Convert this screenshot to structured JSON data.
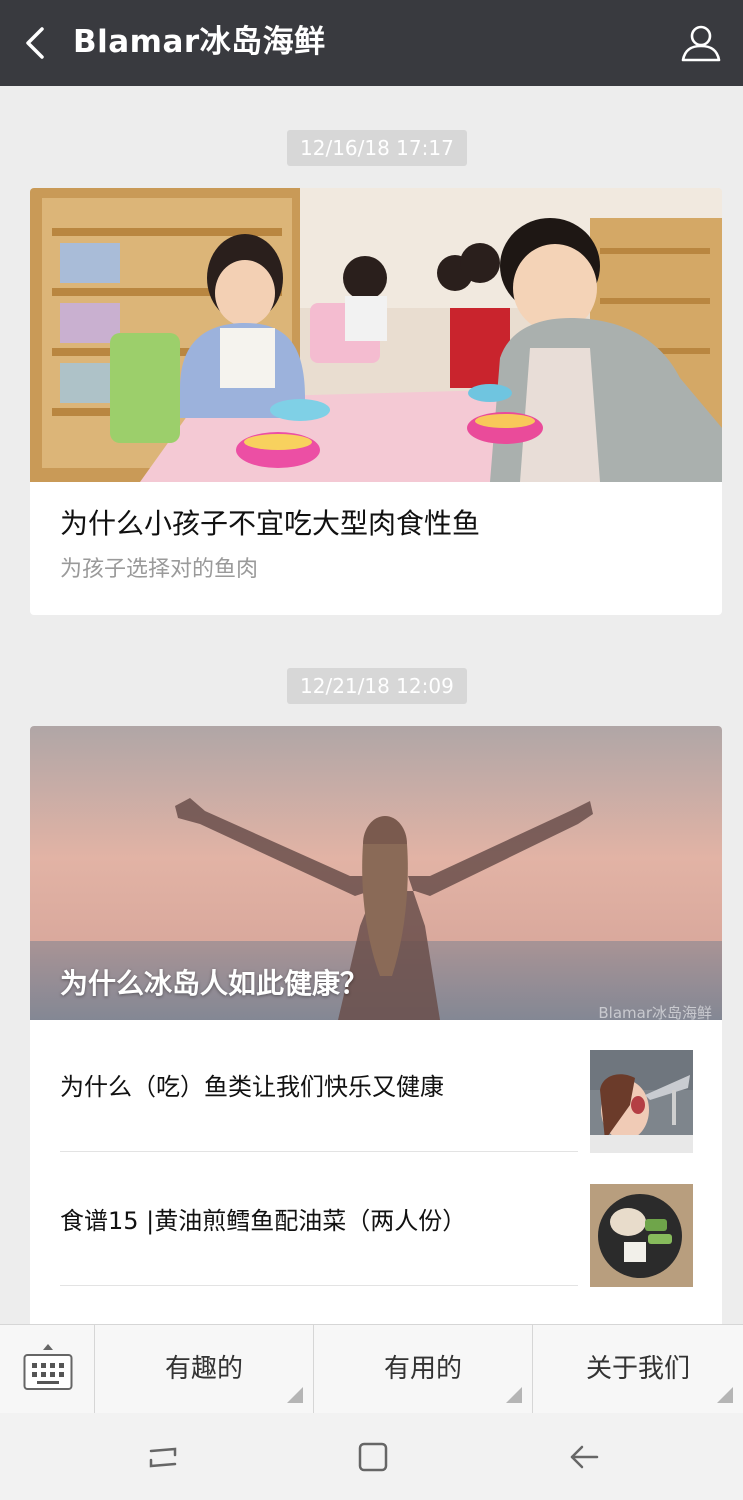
{
  "header": {
    "title": "Blamar冰岛海鲜"
  },
  "feed": {
    "groups": [
      {
        "timestamp": "12/16/18 17:17",
        "cover_title": "",
        "title": "为什么小孩子不宜吃大型肉食性鱼",
        "subtitle": "为孩子选择对的鱼肉"
      },
      {
        "timestamp": "12/21/18 12:09",
        "cover_title": "为什么冰岛人如此健康？",
        "watermark": "Blamar冰岛海鲜",
        "articles": [
          {
            "title": "为什么（吃）鱼类让我们快乐又健康",
            "thumb_icon": "woman-eating-fish-thumbnail"
          },
          {
            "title": "食谱15 |黄油煎鳕鱼配油菜（两人份）",
            "thumb_icon": "cod-dish-thumbnail"
          }
        ]
      }
    ]
  },
  "bottom_menu": {
    "keyboard_icon": "keyboard-icon",
    "items": [
      {
        "label": "有趣的"
      },
      {
        "label": "有用的"
      },
      {
        "label": "关于我们"
      }
    ]
  },
  "system_nav": {
    "icons": [
      "recent-apps-icon",
      "home-icon",
      "back-arrow-icon"
    ]
  },
  "colors": {
    "topbar": "#393a3f",
    "background": "#ededed",
    "stamp": "#d7d7d7"
  }
}
